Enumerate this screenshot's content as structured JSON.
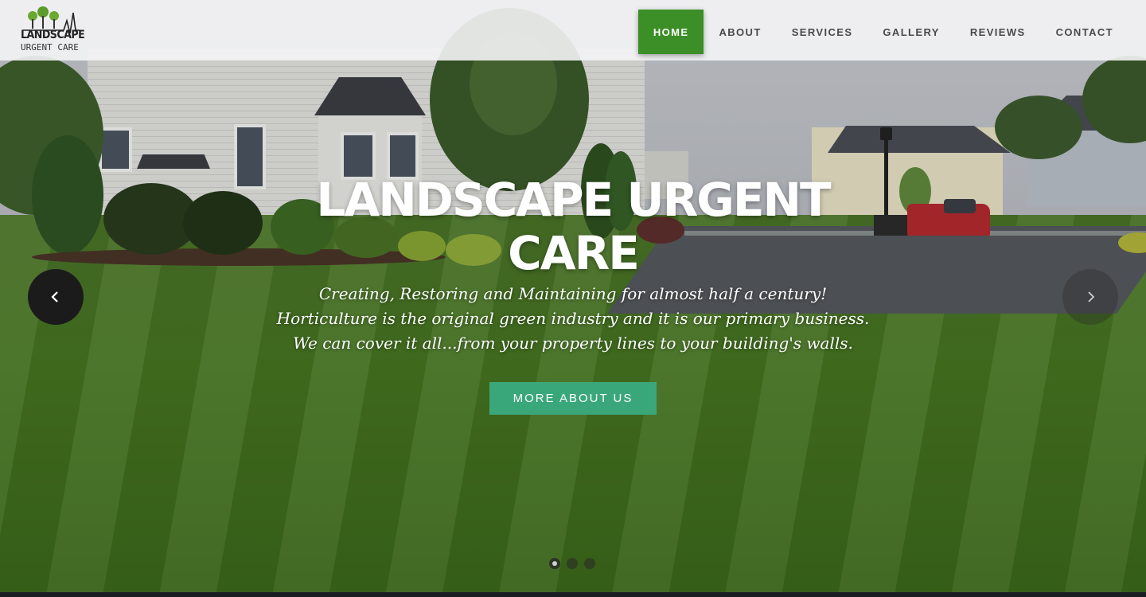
{
  "brand": {
    "logo_line1": "LANDSCAPE",
    "logo_line2": "URGENT CARE",
    "colors": {
      "nav_active": "#3c8f26",
      "cta": "#3aa77a"
    }
  },
  "nav": {
    "items": [
      {
        "label": "HOME",
        "active": true
      },
      {
        "label": "ABOUT",
        "active": false
      },
      {
        "label": "SERVICES",
        "active": false
      },
      {
        "label": "GALLERY",
        "active": false
      },
      {
        "label": "REVIEWS",
        "active": false
      },
      {
        "label": "CONTACT",
        "active": false
      }
    ]
  },
  "hero": {
    "title_line1": "LANDSCAPE URGENT",
    "title_line2": "CARE",
    "subtitle": "Creating, Restoring and Maintaining for almost half a century! Horticulture is the original green industry and it is our primary business. We can cover it all...from your property lines to your building's walls.",
    "cta_label": "MORE ABOUT US",
    "prev_icon": "chevron-left-icon",
    "next_icon": "chevron-right-icon"
  },
  "slider": {
    "slide_count": 3,
    "active_slide": 1
  }
}
